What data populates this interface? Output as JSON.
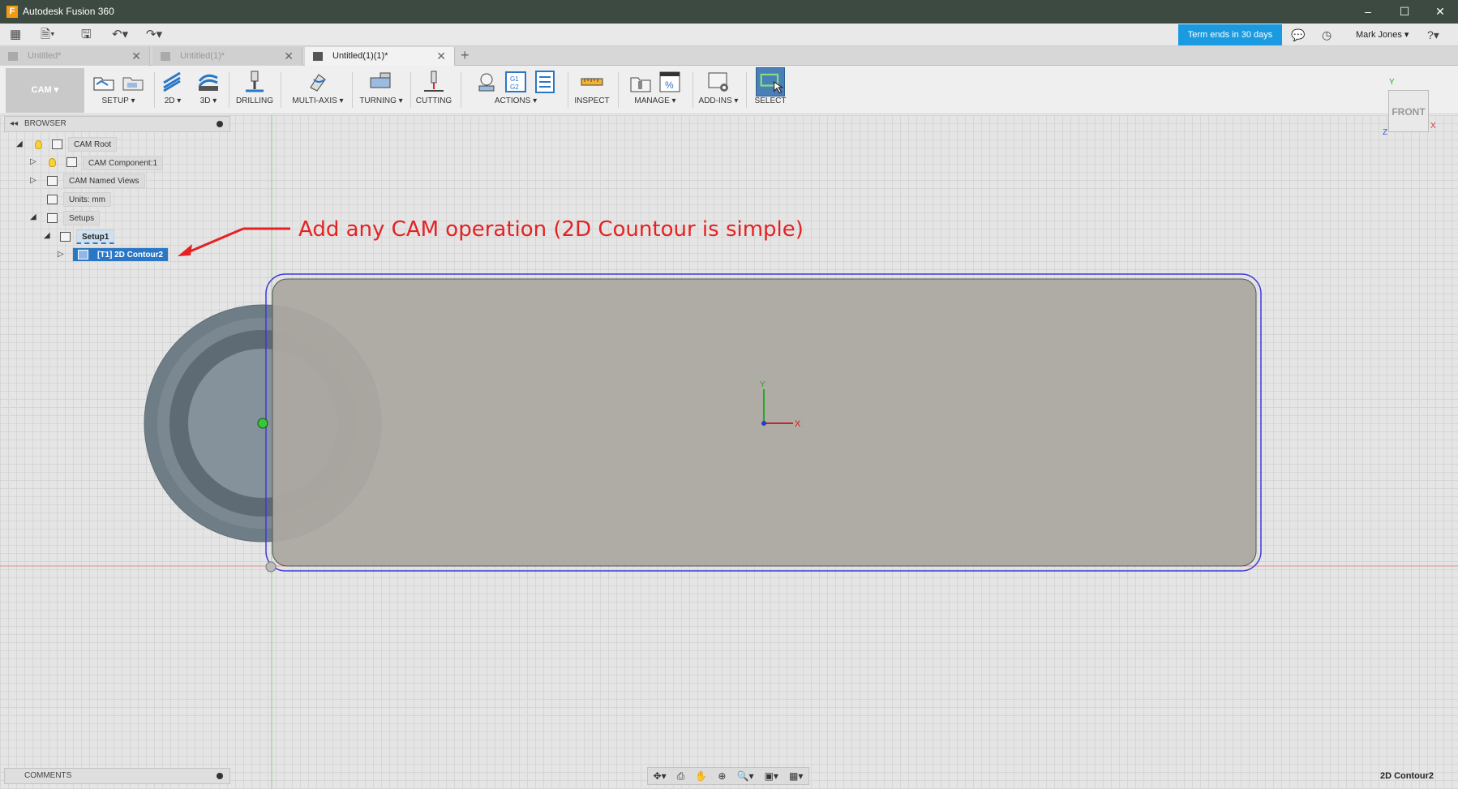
{
  "window": {
    "title": "Autodesk Fusion 360",
    "min": "–",
    "max": "☐",
    "close": "✕"
  },
  "qbar": {
    "apps": "▦",
    "file": "🗎▾",
    "save": "🖫",
    "undo": "↶▾",
    "redo": "↷▾",
    "term": "Term ends in 30 days",
    "comment": "💬",
    "history": "◷",
    "user": "Mark Jones ▾",
    "help": "?▾"
  },
  "tabs": [
    {
      "label": "Untitled*",
      "close": "✕"
    },
    {
      "label": "Untitled(1)*",
      "close": "✕"
    },
    {
      "label": "Untitled(1)(1)*",
      "close": "✕"
    }
  ],
  "tab_add": "+",
  "toolbar": {
    "workspace": "CAM ▾",
    "groups": [
      {
        "label": "SETUP ▾"
      },
      {
        "label": "2D ▾"
      },
      {
        "label": "3D ▾"
      },
      {
        "label": "DRILLING"
      },
      {
        "label": "MULTI-AXIS ▾"
      },
      {
        "label": "TURNING ▾"
      },
      {
        "label": "CUTTING"
      },
      {
        "label": "ACTIONS ▾"
      },
      {
        "label": "INSPECT"
      },
      {
        "label": "MANAGE ▾"
      },
      {
        "label": "ADD-INS ▾"
      },
      {
        "label": "SELECT"
      }
    ]
  },
  "browser": {
    "title": "BROWSER",
    "collapse": "◂◂",
    "nodes": [
      {
        "label": "CAM Root"
      },
      {
        "label": "CAM Component:1"
      },
      {
        "label": "CAM Named Views"
      },
      {
        "label": "Units: mm"
      },
      {
        "label": "Setups"
      },
      {
        "label": "Setup1"
      },
      {
        "label": "[T1] 2D Contour2"
      }
    ]
  },
  "annotation": "Add any CAM operation (2D Countour is simple)",
  "viewcube": {
    "face": "FRONT",
    "axis_y": "Y",
    "axis_x": "X",
    "axis_z": "Z"
  },
  "triad": {
    "x": "X",
    "y": "Y"
  },
  "comments": {
    "title": "COMMENTS"
  },
  "status": {
    "selection": "2D Contour2"
  },
  "navbar": [
    "✥▾",
    "⎙",
    "✋",
    "⊕",
    "🔍▾",
    "▣▾",
    "▦▾"
  ],
  "colors": {
    "accent": "#1a9ae0",
    "annotation": "#e52222",
    "selection": "#2a78c5",
    "titlebar": "#3d4a41"
  }
}
